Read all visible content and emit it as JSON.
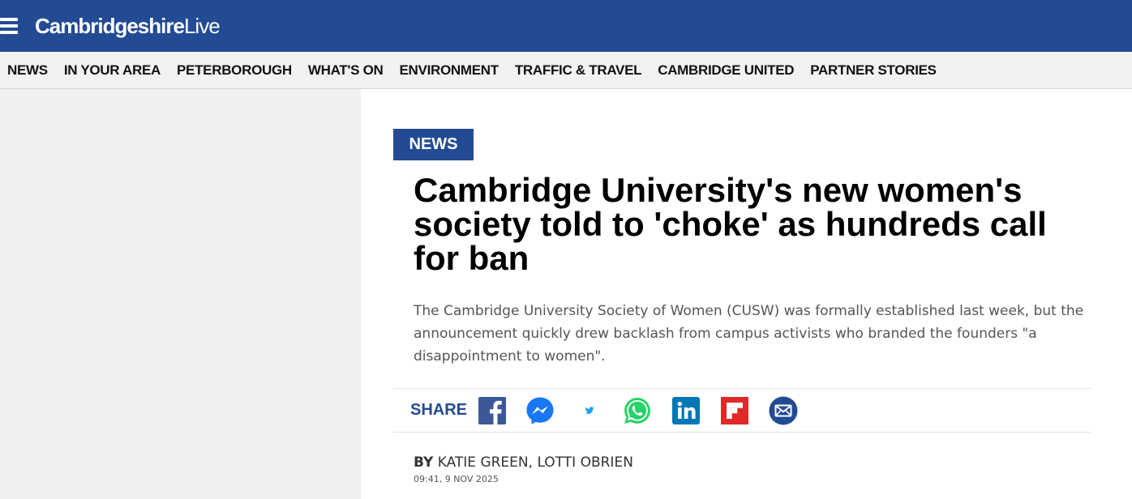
{
  "header": {
    "logo_bold": "Cambridgeshire",
    "logo_light": "Live",
    "brand_color": "#234b94",
    "menu_icon": "hamburger-icon"
  },
  "nav": {
    "items": [
      "NEWS",
      "IN YOUR AREA",
      "PETERBOROUGH",
      "WHAT'S ON",
      "ENVIRONMENT",
      "TRAFFIC & TRAVEL",
      "CAMBRIDGE UNITED",
      "PARTNER STORIES"
    ]
  },
  "article": {
    "section": "NEWS",
    "headline": "Cambridge University's new women's society told to 'choke' as hundreds call for ban",
    "standfirst": "The Cambridge University Society of Women (CUSW) was formally established last week, but the announcement quickly drew backlash from campus activists who branded the founders \"a disappointment to women\".",
    "share_label": "SHARE",
    "share_icons": [
      "facebook-icon",
      "messenger-icon",
      "twitter-icon",
      "whatsapp-icon",
      "linkedin-icon",
      "flipboard-icon",
      "email-icon"
    ],
    "byline_prefix": "BY",
    "authors": "KATIE GREEN, LOTTI OBRIEN",
    "timestamp": "09:41, 9 NOV 2025"
  }
}
